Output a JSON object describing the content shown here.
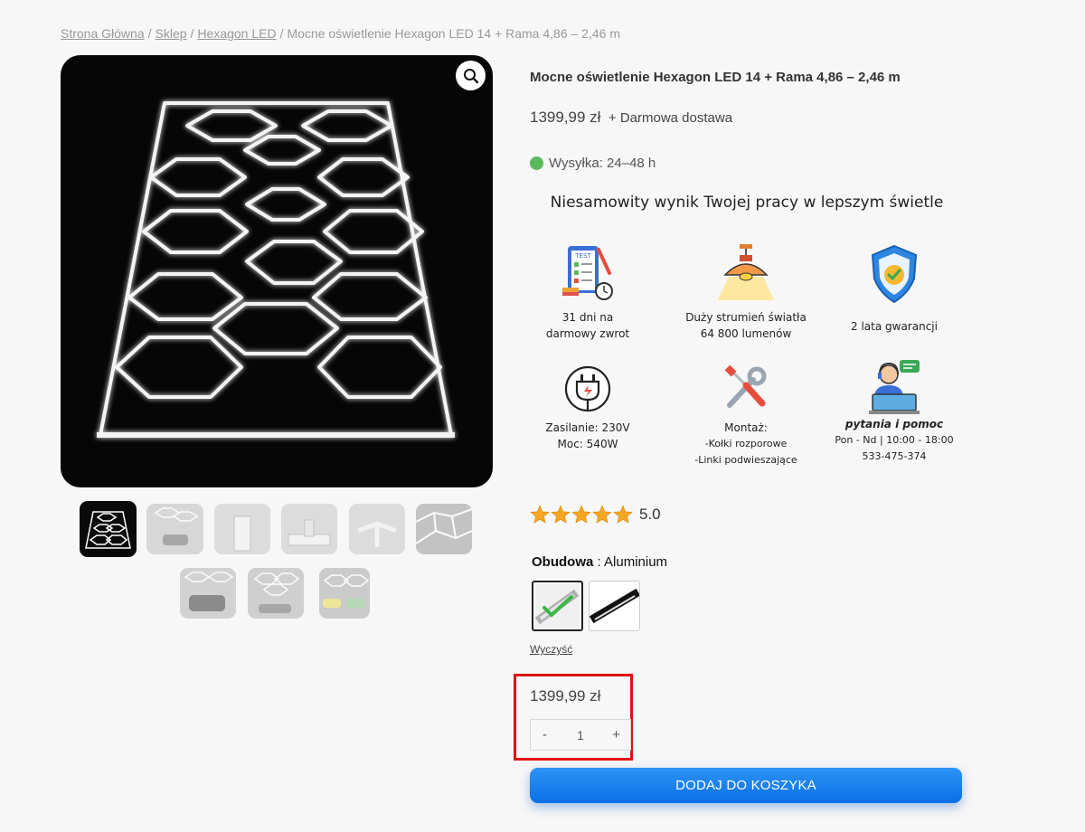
{
  "breadcrumb": {
    "home": "Strona Główna",
    "shop": "Sklep",
    "category": "Hexagon LED",
    "current": "Mocne oświetlenie Hexagon LED 14 + Rama 4,86 – 2,46 m",
    "separator": "/"
  },
  "product": {
    "title": "Mocne oświetlenie Hexagon LED 14 + Rama 4,86 – 2,46 m",
    "price": "1399,99 zł",
    "shipping": "+ Darmowa dostawa",
    "shipping_time": "Wysyłka: 24–48 h",
    "shipping_status_color": "#5cb85c"
  },
  "headline": "Niesamowity wynik Twojej pracy w lepszym świetle",
  "features": [
    {
      "icon": "test-checklist-icon",
      "lines": [
        "31 dni na",
        "darmowy zwrot"
      ]
    },
    {
      "icon": "ceiling-lamp-icon",
      "lines": [
        "Duży strumień światła",
        "64 800 lumenów"
      ]
    },
    {
      "icon": "shield-check-icon",
      "lines": [
        "2 lata gwarancji"
      ]
    },
    {
      "icon": "power-plug-icon",
      "lines": [
        "Zasilanie: 230V",
        "Moc: 540W"
      ]
    },
    {
      "icon": "wrench-screwdriver-icon",
      "title": "Montaż:",
      "lines": [
        "-Kołki rozporowe",
        "-Linki podwieszające"
      ]
    },
    {
      "icon": "support-agent-icon",
      "title": "pytania i pomoc",
      "lines": [
        "Pon - Nd | 10:00 - 18:00",
        "533-475-374"
      ]
    }
  ],
  "rating": {
    "score": "5.0",
    "stars": 5,
    "star_color": "#f5a623"
  },
  "attribute": {
    "name": "Obudowa",
    "separator": " : ",
    "value": "Aluminium",
    "options": [
      "aluminium-silver",
      "black-profile"
    ]
  },
  "clear_label": "Wyczyść",
  "variation_price": "1399,99 zł",
  "quantity": {
    "minus": "-",
    "value": "1",
    "plus": "+"
  },
  "add_to_cart": "DODAJ DO KOSZYKA",
  "gallery": {
    "count": 9,
    "active_index": 0
  },
  "colors": {
    "accent": "#0a6fe6",
    "highlight": "#e01313"
  }
}
